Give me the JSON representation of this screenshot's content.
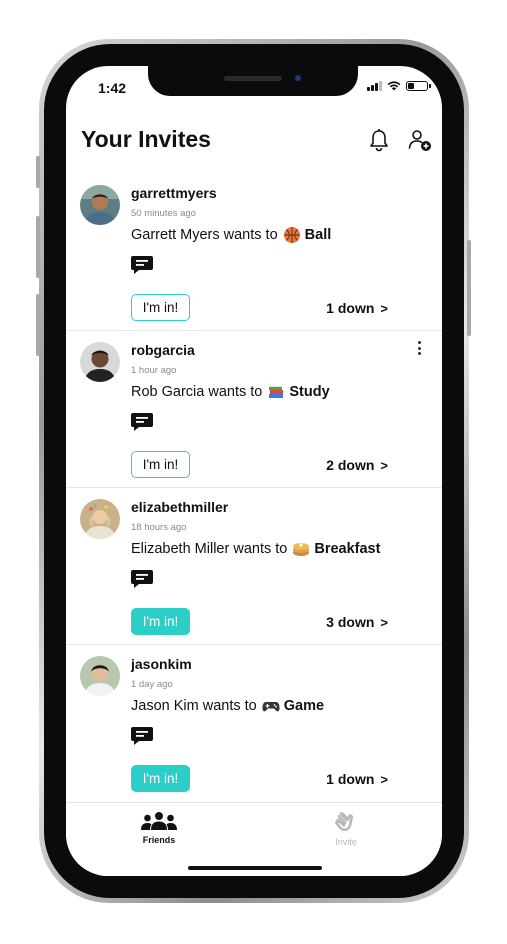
{
  "status_bar": {
    "time": "1:42"
  },
  "header": {
    "title": "Your Invites"
  },
  "invites": [
    {
      "username": "garrettmyers",
      "time_ago": "50 minutes ago",
      "message_prefix": "Garrett Myers wants to",
      "activity": "Ball",
      "activity_icon": "basketball-emoji",
      "button_label": "I'm in!",
      "joined": false,
      "down_label": "1 down"
    },
    {
      "username": "robgarcia",
      "time_ago": "1 hour ago",
      "message_prefix": "Rob Garcia wants to",
      "activity": "Study",
      "activity_icon": "books-emoji",
      "button_label": "I'm in!",
      "joined": false,
      "down_label": "2 down"
    },
    {
      "username": "elizabethmiller",
      "time_ago": "18 hours ago",
      "message_prefix": "Elizabeth Miller wants to",
      "activity": "Breakfast",
      "activity_icon": "pancakes-emoji",
      "button_label": "I'm in!",
      "joined": true,
      "down_label": "3 down"
    },
    {
      "username": "jasonkim",
      "time_ago": "1 day ago",
      "message_prefix": "Jason Kim wants to",
      "activity": "Game",
      "activity_icon": "game-controller-emoji",
      "button_label": "I'm in!",
      "joined": true,
      "down_label": "1 down"
    }
  ],
  "tabbar": {
    "friends_label": "Friends",
    "invite_label": "Invite"
  },
  "colors": {
    "accent": "#2ccfc7",
    "inactive_tab": "#b8b8b8"
  }
}
